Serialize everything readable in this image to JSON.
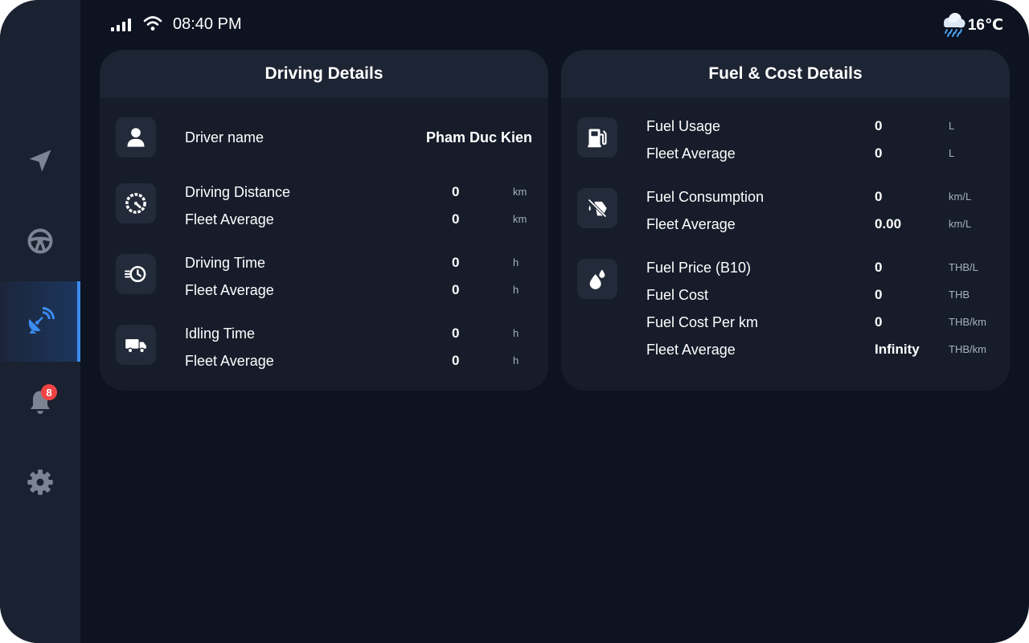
{
  "status": {
    "time": "08:40 PM",
    "temperature": "16℃",
    "weather_icon": "cloud-rain-icon"
  },
  "sidebar": {
    "items": [
      {
        "name": "navigation",
        "icon": "navigation-arrow-icon",
        "active": false
      },
      {
        "name": "driving",
        "icon": "steering-wheel-icon",
        "active": false
      },
      {
        "name": "telematics",
        "icon": "satellite-dish-icon",
        "active": true
      },
      {
        "name": "notifications",
        "icon": "bell-icon",
        "active": false,
        "badge": "8"
      },
      {
        "name": "settings",
        "icon": "gear-icon",
        "active": false
      }
    ],
    "accent": "#3b8cf2"
  },
  "driving": {
    "title": "Driving Details",
    "driver_label": "Driver name",
    "driver_name": "Pham Duc Kien",
    "groups": [
      {
        "icon": "speedometer-icon",
        "rows": [
          {
            "label": "Driving Distance",
            "value": "0",
            "unit": "km"
          },
          {
            "label": "Fleet Average",
            "value": "0",
            "unit": "km"
          }
        ]
      },
      {
        "icon": "stopwatch-icon",
        "rows": [
          {
            "label": "Driving Time",
            "value": "0",
            "unit": "h"
          },
          {
            "label": "Fleet Average",
            "value": "0",
            "unit": "h"
          }
        ]
      },
      {
        "icon": "truck-icon",
        "rows": [
          {
            "label": "Idling Time",
            "value": "0",
            "unit": "h"
          },
          {
            "label": "Fleet Average",
            "value": "0",
            "unit": "h"
          }
        ]
      }
    ]
  },
  "fuel": {
    "title": "Fuel & Cost Details",
    "groups": [
      {
        "icon": "fuel-pump-icon",
        "rows": [
          {
            "label": "Fuel Usage",
            "value": "0",
            "unit": "L"
          },
          {
            "label": "Fleet Average",
            "value": "0",
            "unit": "L"
          }
        ]
      },
      {
        "icon": "fuel-nozzle-icon",
        "rows": [
          {
            "label": "Fuel Consumption",
            "value": "0",
            "unit": "km/L"
          },
          {
            "label": "Fleet Average",
            "value": "0.00",
            "unit": "km/L"
          }
        ]
      },
      {
        "icon": "fuel-drop-icon",
        "rows": [
          {
            "label": "Fuel Price (B10)",
            "value": "0",
            "unit": "THB/L"
          },
          {
            "label": "Fuel Cost",
            "value": "0",
            "unit": "THB"
          },
          {
            "label": "Fuel Cost Per km",
            "value": "0",
            "unit": "THB/km"
          },
          {
            "label": "Fleet Average",
            "value": "Infinity",
            "unit": "THB/km"
          }
        ]
      }
    ]
  }
}
